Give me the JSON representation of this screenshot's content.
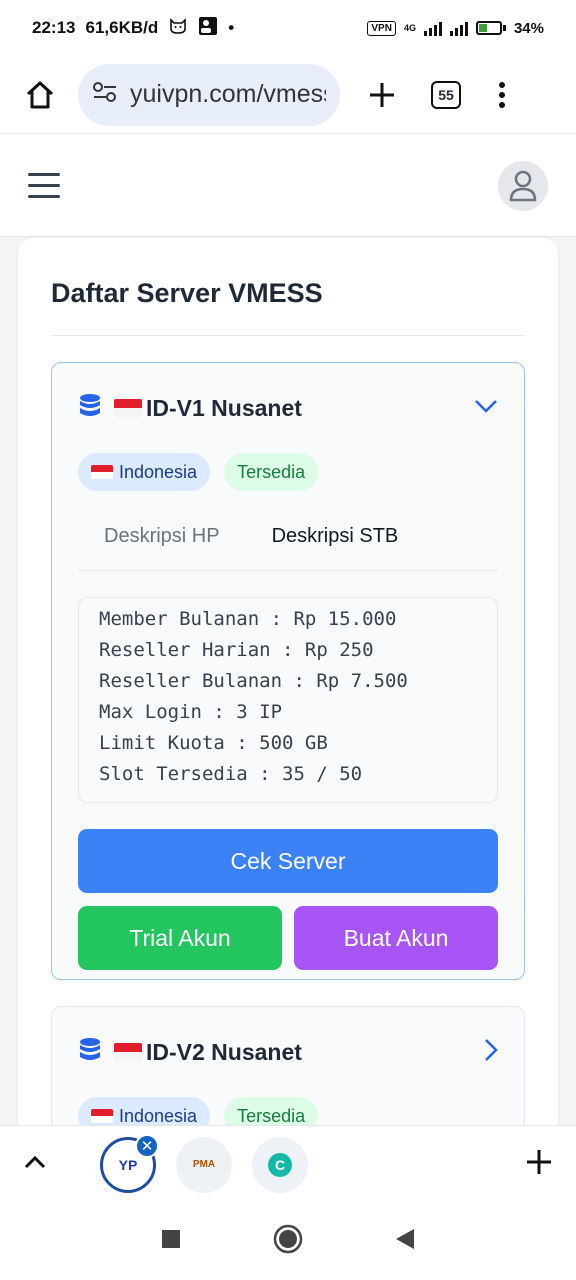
{
  "status_bar": {
    "time": "22:13",
    "net_speed": "61,6KB/d",
    "dot": "•",
    "vpn": "VPN",
    "network": "4G",
    "battery": "34%"
  },
  "browser": {
    "url": "yuivpn.com/vmess",
    "tab_count": "55"
  },
  "page": {
    "title": "Daftar Server VMESS",
    "servers": [
      {
        "name": "ID-V1 Nusanet",
        "country": "Indonesia",
        "status": "Tersedia",
        "tabs": [
          "Deskripsi HP",
          "Deskripsi STB"
        ],
        "active_tab": "Deskripsi STB",
        "description_lines": [
          "Member Bulanan : Rp 15.000",
          "Reseller Harian : Rp 250",
          "Reseller Bulanan : Rp 7.500",
          "Max Login : 3 IP",
          "Limit Kuota : 500 GB",
          "Slot Tersedia : 35 / 50"
        ],
        "buttons": {
          "cek": "Cek Server",
          "trial": "Trial Akun",
          "buat": "Buat Akun"
        }
      },
      {
        "name": "ID-V2 Nusanet",
        "country": "Indonesia",
        "status": "Tersedia"
      }
    ]
  },
  "bottom_tabs": {
    "tab1": "YP",
    "tab2": "PMA",
    "tab3": "C"
  },
  "colors": {
    "accent_blue": "#3b82f6",
    "green": "#22c55e",
    "purple": "#a855f7",
    "flag_red": "#e11d2a"
  }
}
